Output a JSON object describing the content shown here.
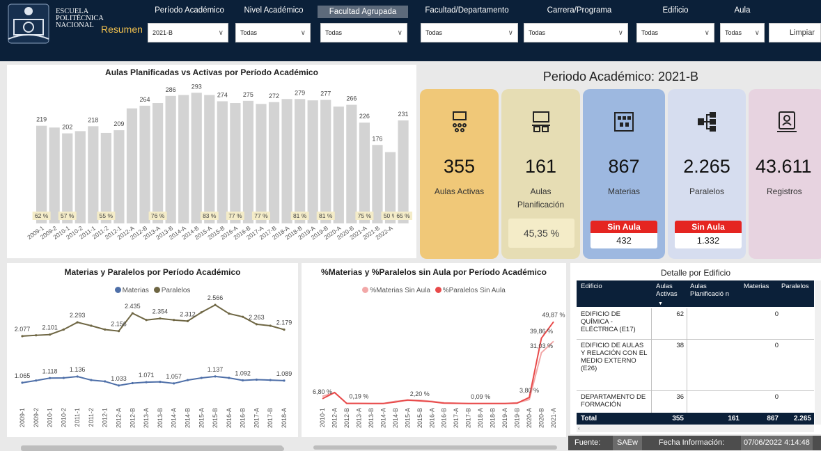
{
  "header": {
    "brand_lines": [
      "ESCUELA",
      "POLITÉCNICA",
      "NACIONAL"
    ],
    "page_label": "Resumen",
    "clear_label": "Limpiar",
    "filters": [
      {
        "label": "Período Académico",
        "value": "2021-B"
      },
      {
        "label": "Nivel Académico",
        "value": "Todas"
      },
      {
        "label": "Facultad Agrupada",
        "value": "Todas"
      },
      {
        "label": "Facultad/Departamento",
        "value": "Todas"
      },
      {
        "label": "Carrera/Programa",
        "value": "Todas"
      },
      {
        "label": "Edificio",
        "value": "Todas"
      },
      {
        "label": "Aula",
        "value": "Todas"
      }
    ]
  },
  "kpi": {
    "title": "Periodo Académico: 2021-B",
    "cards": [
      {
        "value": "355",
        "label": "Aulas Activas",
        "color": "#f0c878",
        "icon": "classroom-network-icon"
      },
      {
        "value": "161",
        "label": "Aulas Planificación",
        "color": "#e6ddb4",
        "icon": "classroom-desk-icon",
        "extra": "45,35 %"
      },
      {
        "value": "867",
        "label": "Materias",
        "color": "#9db8e0",
        "icon": "building-icon",
        "sin_aula_label": "Sin Aula",
        "sin_aula": "432"
      },
      {
        "value": "2.265",
        "label": "Paralelos",
        "color": "#d6ddef",
        "icon": "hierarchy-icon",
        "sin_aula_label": "Sin Aula",
        "sin_aula": "1.332"
      },
      {
        "value": "43.611",
        "label": "Registros",
        "color": "#e7d3e0",
        "icon": "id-card-icon"
      }
    ]
  },
  "chart_data": [
    {
      "type": "bar",
      "title": "Aulas Planificadas vs Activas por Período Académico",
      "categories": [
        "2009-1",
        "2009-2",
        "2010-1",
        "2010-2",
        "2011-1",
        "2011-2",
        "2012-1",
        "2012-A",
        "2012-B",
        "2013-A",
        "2013-B",
        "2014-A",
        "2014-B",
        "2015-A",
        "2015-B",
        "2016-A",
        "2016-B",
        "2017-A",
        "2017-B",
        "2018-A",
        "2018-B",
        "2019-A",
        "2019-B",
        "2020-A",
        "2020-B",
        "2021-A",
        "2021-B",
        "2022-A"
      ],
      "series": [
        {
          "values": [
            219,
            215,
            202,
            207,
            218,
            203,
            209,
            258,
            264,
            270,
            286,
            288,
            293,
            288,
            274,
            270,
            275,
            268,
            272,
            279,
            279,
            276,
            277,
            262,
            266,
            226,
            176,
            160,
            231
          ]
        },
        {
          "labels": [
            "62 %",
            "57 %",
            "",
            "55 %",
            "",
            "76 %",
            "",
            "83 %",
            "77 %",
            "77 %",
            "",
            "81 %",
            "81 %",
            "",
            "75 %",
            "50 %",
            "65 %"
          ]
        }
      ],
      "value_labels": [
        {
          "i": 0,
          "text": "219"
        },
        {
          "i": 2,
          "text": "202"
        },
        {
          "i": 4,
          "text": "218"
        },
        {
          "i": 6,
          "text": "209"
        },
        {
          "i": 8,
          "text": "264"
        },
        {
          "i": 10,
          "text": "286"
        },
        {
          "i": 12,
          "text": "293"
        },
        {
          "i": 14,
          "text": "274"
        },
        {
          "i": 16,
          "text": "275"
        },
        {
          "i": 18,
          "text": "272"
        },
        {
          "i": 20,
          "text": "279"
        },
        {
          "i": 22,
          "text": "277"
        },
        {
          "i": 24,
          "text": "266"
        },
        {
          "i": 25,
          "text": "226"
        },
        {
          "i": 26,
          "text": "176"
        },
        {
          "i": 28,
          "text": "231"
        }
      ],
      "pct_labels": [
        {
          "i": 0,
          "text": "62 %"
        },
        {
          "i": 2,
          "text": "57 %"
        },
        {
          "i": 5,
          "text": "55 %"
        },
        {
          "i": 9,
          "text": "76 %"
        },
        {
          "i": 13,
          "text": "83 %"
        },
        {
          "i": 15,
          "text": "77 %"
        },
        {
          "i": 17,
          "text": "77 %"
        },
        {
          "i": 20,
          "text": "81 %"
        },
        {
          "i": 22,
          "text": "81 %"
        },
        {
          "i": 25,
          "text": "75 %"
        },
        {
          "i": 27,
          "text": "50 %"
        },
        {
          "i": 28,
          "text": "65 %"
        }
      ]
    },
    {
      "type": "line",
      "title": "Materias y Paralelos por Período Académico",
      "legend": [
        "Materias",
        "Paralelos"
      ],
      "categories": [
        "2009-1",
        "2009-2",
        "2010-1",
        "2010-2",
        "2011-1",
        "2011-2",
        "2012-1",
        "2012-A",
        "2012-B",
        "2013-A",
        "2013-B",
        "2014-A",
        "2014-B",
        "2015-A",
        "2015-B",
        "2016-A",
        "2016-B",
        "2017-A",
        "2017-B",
        "2018-A"
      ],
      "series": [
        {
          "name": "Materias",
          "color": "#4e6fa8",
          "values": [
            1065,
            1090,
            1118,
            1120,
            1136,
            1095,
            1080,
            1033,
            1060,
            1071,
            1075,
            1057,
            1095,
            1120,
            1137,
            1120,
            1092,
            1100,
            1095,
            1089
          ]
        },
        {
          "name": "Paralelos",
          "color": "#6e6643",
          "values": [
            2077,
            2090,
            2101,
            2180,
            2293,
            2240,
            2180,
            2156,
            2435,
            2330,
            2354,
            2330,
            2312,
            2450,
            2566,
            2430,
            2380,
            2263,
            2240,
            2179
          ]
        }
      ],
      "value_labels": [
        {
          "s": 1,
          "i": 0,
          "text": "2.077"
        },
        {
          "s": 1,
          "i": 2,
          "text": "2.101"
        },
        {
          "s": 1,
          "i": 4,
          "text": "2.293"
        },
        {
          "s": 1,
          "i": 7,
          "text": "2.156"
        },
        {
          "s": 1,
          "i": 8,
          "text": "2.435"
        },
        {
          "s": 1,
          "i": 10,
          "text": "2.354"
        },
        {
          "s": 1,
          "i": 12,
          "text": "2.312"
        },
        {
          "s": 1,
          "i": 14,
          "text": "2.566"
        },
        {
          "s": 1,
          "i": 17,
          "text": "2.263"
        },
        {
          "s": 1,
          "i": 19,
          "text": "2.179"
        },
        {
          "s": 0,
          "i": 0,
          "text": "1.065"
        },
        {
          "s": 0,
          "i": 2,
          "text": "1.118"
        },
        {
          "s": 0,
          "i": 4,
          "text": "1.136"
        },
        {
          "s": 0,
          "i": 7,
          "text": "1.033"
        },
        {
          "s": 0,
          "i": 9,
          "text": "1.071"
        },
        {
          "s": 0,
          "i": 11,
          "text": "1.057"
        },
        {
          "s": 0,
          "i": 14,
          "text": "1.137"
        },
        {
          "s": 0,
          "i": 16,
          "text": "1.092"
        },
        {
          "s": 0,
          "i": 19,
          "text": "1.089"
        }
      ]
    },
    {
      "type": "line",
      "title": "%Materias y %Paralelos sin Aula por Período Académico",
      "legend": [
        "%Materias Sin Aula",
        "%Paralelos Sin Aula"
      ],
      "categories": [
        "2010-1",
        "2012-A",
        "2012-B",
        "2013-A",
        "2013-B",
        "2014-A",
        "2014-B",
        "2015-A",
        "2015-B",
        "2016-A",
        "2016-B",
        "2017-A",
        "2017-B",
        "2018-A",
        "2018-B",
        "2019-A",
        "2019-B",
        "2020-A",
        "2020-B",
        "2021-A"
      ],
      "series": [
        {
          "name": "%Materias Sin Aula",
          "color": "#f2a8a8",
          "values": [
            4.5,
            6.8,
            0.19,
            0.19,
            0.1,
            0.1,
            1.5,
            2.0,
            2.0,
            1.5,
            0.5,
            0.3,
            0.09,
            0.09,
            0.09,
            0.1,
            0.5,
            2.5,
            31.03,
            38.0
          ]
        },
        {
          "name": "%Paralelos Sin Aula",
          "color": "#e84a4a",
          "values": [
            3.0,
            6.8,
            0.19,
            0.19,
            0.1,
            0.1,
            1.0,
            2.2,
            1.7,
            1.2,
            0.3,
            0.2,
            0.09,
            0.09,
            0.09,
            0.1,
            0.3,
            3.8,
            39.86,
            49.87
          ]
        }
      ],
      "value_labels": [
        {
          "s": 1,
          "i": 0,
          "text": "6,80 %"
        },
        {
          "s": 0,
          "i": 3,
          "text": "0,19 %"
        },
        {
          "s": 1,
          "i": 8,
          "text": "2,20 %"
        },
        {
          "s": 0,
          "i": 13,
          "text": "0,09 %"
        },
        {
          "s": 1,
          "i": 17,
          "text": "3,80 %"
        },
        {
          "s": 0,
          "i": 18,
          "text": "31,03 %"
        },
        {
          "s": 1,
          "i": 18,
          "text": "39,86 %"
        },
        {
          "s": 1,
          "i": 19,
          "text": "49,87 %"
        }
      ]
    }
  ],
  "table": {
    "title": "Detalle por Edificio",
    "headers": [
      "Edificio",
      "Aulas Activas",
      "Aulas Planificació n",
      "Materias",
      "Paralelos"
    ],
    "rows": [
      {
        "name": "EDIFICIO DE QUÍMICA - ELÉCTRICA (E17)",
        "activas": "62",
        "planif": "",
        "materias": "0",
        "paralelos": ""
      },
      {
        "name": "EDIFICIO DE AULAS Y RELACIÓN CON EL MEDIO EXTERNO (E26)",
        "activas": "38",
        "planif": "",
        "materias": "0",
        "paralelos": ""
      },
      {
        "name": "DEPARTAMENTO DE FORMACIÓN",
        "activas": "36",
        "planif": "",
        "materias": "0",
        "paralelos": ""
      }
    ],
    "total": {
      "label": "Total",
      "activas": "355",
      "planif": "161",
      "materias": "867",
      "paralelos": "2.265"
    }
  },
  "footer": {
    "source_label": "Fuente:",
    "source": "SAEw",
    "date_label": "Fecha Información:",
    "date": "07/06/2022 4:14:48"
  }
}
